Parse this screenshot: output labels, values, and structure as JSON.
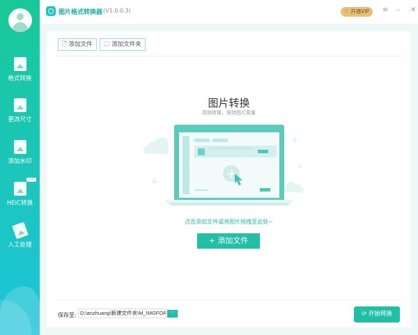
{
  "app": {
    "title": "图片格式转换器",
    "version": "(V1.0.0.3)",
    "vip_label": "开通VIP",
    "menu": "≡",
    "minimize": "–",
    "close": "✕"
  },
  "sidebar": {
    "items": [
      {
        "label": "格式转换"
      },
      {
        "label": "更改尺寸"
      },
      {
        "label": "添加水印"
      },
      {
        "label": "HEIC转换",
        "badge": "VIP"
      },
      {
        "label": "人工处理"
      }
    ]
  },
  "toolbar": {
    "add_file": "添加文件",
    "add_folder": "添加文件夹"
  },
  "main": {
    "title": "图片转换",
    "subtitle": "高效转换，保持图片质量",
    "hint": "点击添加文件或将图片拖拽至此处~",
    "add_button": "+ 添加文件"
  },
  "footer": {
    "save_label": "保存至:",
    "path": "D:\\anzhuang\\新建文件夹\\M_IMGFORMAT",
    "browse": "···",
    "start": "开始转换"
  },
  "colors": {
    "accent": "#21bfa5",
    "vip": "#e7c07a"
  }
}
